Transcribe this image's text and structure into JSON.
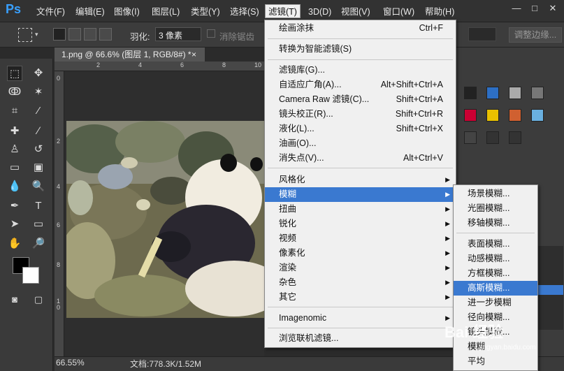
{
  "app": {
    "logo": "Ps"
  },
  "menubar": {
    "items": [
      "文件(F)",
      "编辑(E)",
      "图像(I)",
      "图层(L)",
      "类型(Y)",
      "选择(S)",
      "滤镜(T)",
      "3D(D)",
      "视图(V)",
      "窗口(W)",
      "帮助(H)"
    ],
    "active_index": 6
  },
  "window_controls": {
    "minimize": "—",
    "maximize": "□",
    "close": "✕"
  },
  "options": {
    "feather_label": "羽化:",
    "feather_value": "3 像素",
    "antialias_label": "消除锯齿",
    "adjust_edge_label": "调整边缘..."
  },
  "document": {
    "tab_title": "1.png @ 66.6% (图层 1, RGB/8#) *",
    "tab_close": "×",
    "ruler_top_ticks": [
      "2",
      "4",
      "6",
      "8",
      "10"
    ],
    "ruler_left_ticks": [
      "0",
      "2",
      "4",
      "6",
      "8",
      "1\n0"
    ]
  },
  "status": {
    "zoom": "66.55%",
    "doc_info": "文档:778.3K/1.52M"
  },
  "filter_menu": {
    "items": [
      {
        "label": "绘画涂抹",
        "shortcut": "Ctrl+F"
      },
      {
        "label": "转换为智能滤镜(S)",
        "shortcut": ""
      },
      {
        "label": "滤镜库(G)...",
        "shortcut": ""
      },
      {
        "label": "自适应广角(A)...",
        "shortcut": "Alt+Shift+Ctrl+A"
      },
      {
        "label": "Camera Raw 滤镜(C)...",
        "shortcut": "Shift+Ctrl+A"
      },
      {
        "label": "镜头校正(R)...",
        "shortcut": "Shift+Ctrl+R"
      },
      {
        "label": "液化(L)...",
        "shortcut": "Shift+Ctrl+X"
      },
      {
        "label": "油画(O)...",
        "shortcut": ""
      },
      {
        "label": "消失点(V)...",
        "shortcut": "Alt+Ctrl+V"
      },
      {
        "label": "风格化",
        "submenu": true
      },
      {
        "label": "模糊",
        "submenu": true,
        "highlighted": true
      },
      {
        "label": "扭曲",
        "submenu": true
      },
      {
        "label": "锐化",
        "submenu": true
      },
      {
        "label": "视频",
        "submenu": true
      },
      {
        "label": "像素化",
        "submenu": true
      },
      {
        "label": "渲染",
        "submenu": true
      },
      {
        "label": "杂色",
        "submenu": true
      },
      {
        "label": "其它",
        "submenu": true
      },
      {
        "label": "Imagenomic",
        "submenu": true
      },
      {
        "label": "浏览联机滤镜...",
        "shortcut": ""
      }
    ]
  },
  "blur_menu": {
    "items": [
      {
        "label": "场景模糊..."
      },
      {
        "label": "光圈模糊..."
      },
      {
        "label": "移轴模糊..."
      },
      {
        "label": "表面模糊..."
      },
      {
        "label": "动感模糊..."
      },
      {
        "label": "方框模糊..."
      },
      {
        "label": "高斯模糊...",
        "highlighted": true
      },
      {
        "label": "进一步模糊"
      },
      {
        "label": "径向模糊..."
      },
      {
        "label": "镜头模糊..."
      },
      {
        "label": "模糊"
      },
      {
        "label": "平均"
      }
    ]
  },
  "watermark": {
    "text": "Bai 经验",
    "sub": "jingyan.baidu.com"
  },
  "colors": {
    "accent": "#3a79d0",
    "ps_blue": "#39a0ff"
  }
}
